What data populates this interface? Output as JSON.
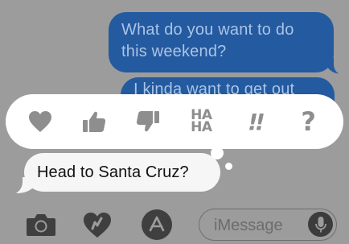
{
  "messages": {
    "outgoing": [
      {
        "text": "What do you want to do\nthis weekend?"
      },
      {
        "text": "I kinda want to get out"
      }
    ],
    "incoming": [
      {
        "text": "Head to Santa Cruz?"
      }
    ]
  },
  "tapback": {
    "options": [
      {
        "icon": "heart-icon"
      },
      {
        "icon": "thumbs-up-icon"
      },
      {
        "icon": "thumbs-down-icon"
      },
      {
        "icon": "haha-icon",
        "label": "HA\nHA"
      },
      {
        "icon": "exclamation-icon",
        "label": "!!"
      },
      {
        "icon": "question-icon",
        "label": "?"
      }
    ],
    "colors": {
      "bar": "#ffffff",
      "glyph": "#8e8e8e"
    }
  },
  "input_bar": {
    "placeholder": "iMessage",
    "icons": [
      "camera-icon",
      "digital-touch-icon",
      "app-store-icon",
      "microphone-icon"
    ]
  },
  "colors": {
    "outgoing_bubble": "#245a9f",
    "incoming_bubble": "#f6f6f6",
    "dim_background": "#9c9c9c"
  }
}
